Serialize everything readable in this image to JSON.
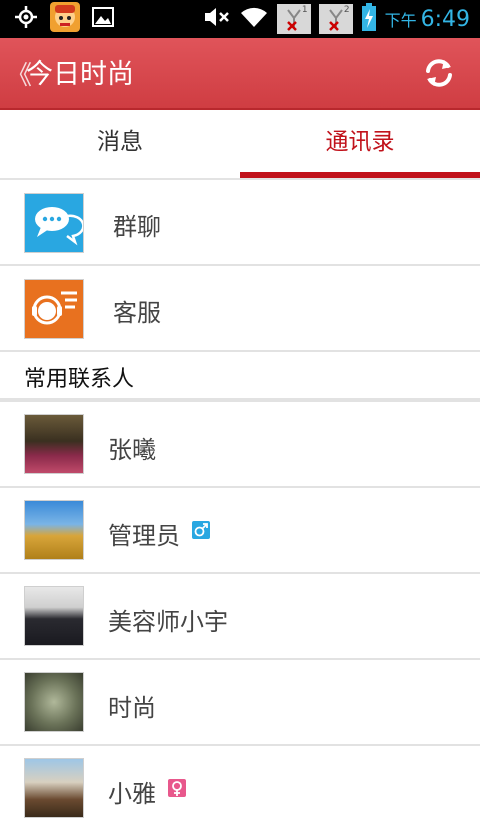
{
  "status_bar": {
    "time": "6:49",
    "ampm": "下午",
    "notif_badge_1": "1",
    "notif_badge_2": "2"
  },
  "app_bar": {
    "title": "今日时尚",
    "back_glyph": "《"
  },
  "tabs": [
    {
      "label": "消息",
      "selected": false
    },
    {
      "label": "通讯录",
      "selected": true
    }
  ],
  "entries": [
    {
      "label": "群聊",
      "icon": "group-chat-icon"
    },
    {
      "label": "客服",
      "icon": "customer-service-icon"
    }
  ],
  "section_title": "常用联系人",
  "contacts": [
    {
      "name": "张曦",
      "gender": ""
    },
    {
      "name": "管理员",
      "gender": "male"
    },
    {
      "name": "美容师小宇",
      "gender": ""
    },
    {
      "name": "时尚",
      "gender": ""
    },
    {
      "name": "小雅",
      "gender": "female"
    }
  ],
  "colors": {
    "app_bar": "#d9474c",
    "accent": "#c1121b",
    "male_badge": "#29a7e1",
    "female_badge": "#e8588c"
  }
}
